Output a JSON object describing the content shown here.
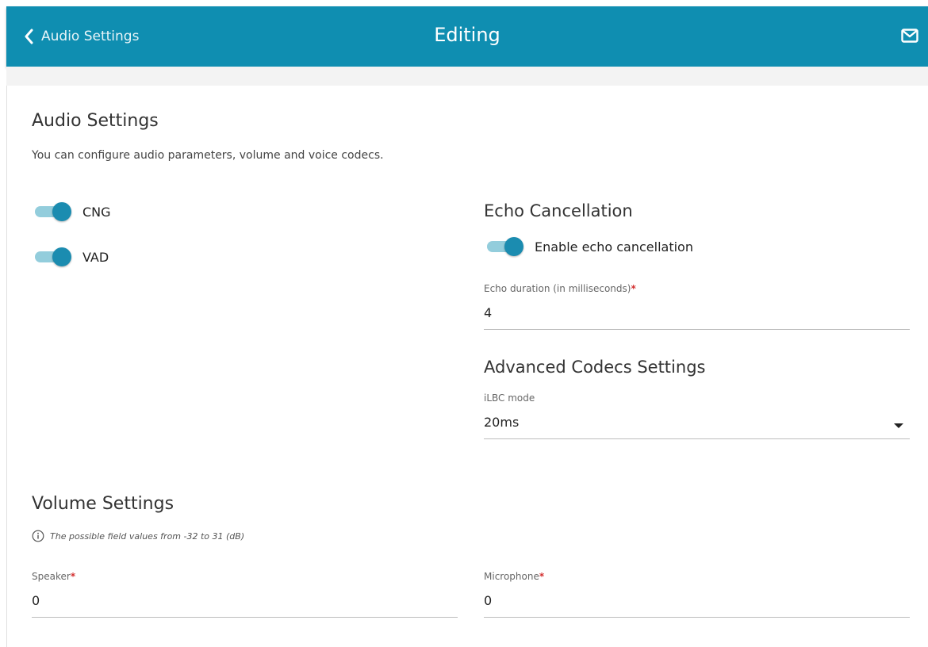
{
  "header": {
    "back_label": "Audio Settings",
    "title": "Editing",
    "icons": [
      "chevron-left-icon",
      "mail-icon"
    ],
    "color": "#0f8eb1"
  },
  "audio": {
    "title": "Audio Settings",
    "description": "You can configure audio parameters, volume and voice codecs.",
    "toggles": [
      {
        "label": "CNG",
        "on": true
      },
      {
        "label": "VAD",
        "on": true
      }
    ]
  },
  "echo": {
    "title": "Echo Cancellation",
    "toggle_label": "Enable echo cancellation",
    "toggle_on": true,
    "duration_label": "Echo duration (in milliseconds)",
    "required_mark": "*",
    "duration_value": "4"
  },
  "codecs": {
    "title": "Advanced Codecs Settings",
    "ilbc_label": "iLBC mode",
    "ilbc_value": "20ms"
  },
  "volume": {
    "title": "Volume Settings",
    "hint": "The possible field values from -32 to 31 (dB)",
    "speaker_label": "Speaker",
    "speaker_value": "0",
    "microphone_label": "Microphone",
    "microphone_value": "0",
    "required_mark": "*"
  },
  "colors": {
    "accent": "#1b8cb0",
    "toggle_track": "#93cddc",
    "required": "#d32f2f"
  }
}
